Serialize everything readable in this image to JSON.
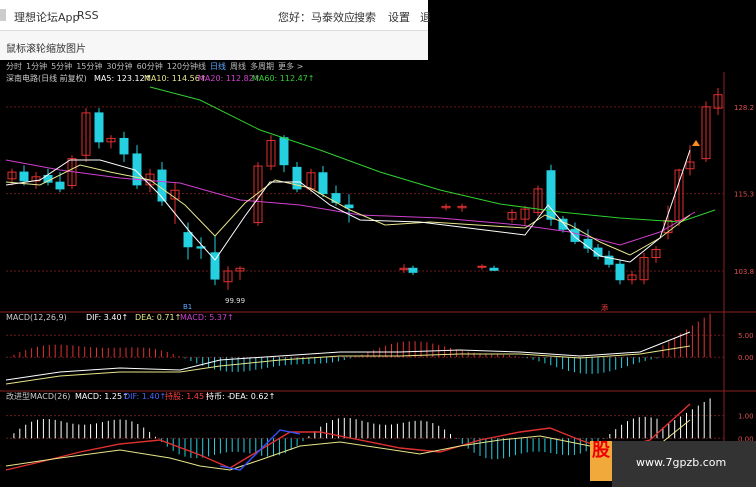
{
  "header": {
    "brand": "理想论坛App",
    "rss": "RSS",
    "greeting": "您好：马泰效应",
    "search_label": "搜索",
    "settings_label": "设置",
    "more_label": "退"
  },
  "subbar": {
    "text": "鼠标滚轮缩放图片"
  },
  "periods": [
    "分时",
    "1分钟",
    "5分钟",
    "15分钟",
    "30分钟",
    "60分钟",
    "120分钟线",
    "日线",
    "周线",
    "多周期",
    "更多 >"
  ],
  "active_period": "日线",
  "colors": {
    "bg": "#000000",
    "up": "#e03030",
    "down": "#25d0e0",
    "ma5": "#ffffff",
    "ma10": "#e8e68a",
    "ma20": "#d040d0",
    "ma60": "#30d030",
    "grid": "#6a1a1a"
  },
  "main": {
    "stock_title": "深南电路(日线 前复权)",
    "ma5": "MA5: 123.12↑",
    "ma10": "MA10: 114.56↑",
    "ma20": "MA20: 112.82↑",
    "ma60": "MA60: 112.47↑",
    "low_marker": "99.99",
    "marker_b1": "B1",
    "marker_red": "添"
  },
  "macd1": {
    "title": "MACD(12,26,9)",
    "dif": "DIF: 3.40↑",
    "dea": "DEA: 0.71↑",
    "macd": "MACD: 5.37↑"
  },
  "macd2": {
    "title": "改进型MACD(26)",
    "macd": "MACD: 1.25↑",
    "dif": "DIF: 1.40↑",
    "hold": "持股: 1.45↑",
    "hold_coin": "持币: -",
    "dea": "DEA: 0.62↑"
  },
  "watermark": {
    "logo": "股",
    "site": "www.7gpzb.com"
  },
  "chart_data": [
    {
      "type": "candlestick",
      "series_name": "深南电路",
      "y_ticks": [
        "128.2",
        "115.3",
        "103.8"
      ],
      "ylim": [
        98,
        131
      ],
      "x": [
        1,
        2,
        3,
        4,
        5,
        6,
        7,
        8,
        9,
        10,
        11,
        12,
        13,
        14,
        15,
        16,
        17,
        18,
        19,
        20,
        21,
        22,
        23,
        24,
        25,
        26,
        27,
        28,
        29,
        30,
        31,
        32,
        33,
        34,
        35,
        36,
        37,
        38,
        39,
        40,
        41,
        42,
        43,
        44,
        45,
        46,
        47,
        48,
        49,
        50,
        51,
        52,
        53,
        54,
        55,
        56,
        57,
        58,
        59,
        60,
        61,
        62,
        63,
        64,
        65,
        66,
        67,
        68,
        69,
        70
      ],
      "candles": [
        {
          "o": 117.5,
          "h": 119,
          "l": 116.5,
          "c": 118.5
        },
        {
          "o": 118.5,
          "h": 119.5,
          "l": 116.5,
          "c": 117.2
        },
        {
          "o": 117.2,
          "h": 118.5,
          "l": 116,
          "c": 117.8
        },
        {
          "o": 118,
          "h": 119,
          "l": 116.5,
          "c": 117
        },
        {
          "o": 117,
          "h": 118.5,
          "l": 115.5,
          "c": 116
        },
        {
          "o": 116.5,
          "h": 121,
          "l": 116,
          "c": 120.5
        },
        {
          "o": 121,
          "h": 128,
          "l": 120,
          "c": 127.3
        },
        {
          "o": 127.3,
          "h": 128,
          "l": 122,
          "c": 123
        },
        {
          "o": 123,
          "h": 124,
          "l": 122,
          "c": 123.5
        },
        {
          "o": 123.5,
          "h": 124.5,
          "l": 120,
          "c": 121.2
        },
        {
          "o": 121.2,
          "h": 122.5,
          "l": 116,
          "c": 116.6
        },
        {
          "o": 116.6,
          "h": 119,
          "l": 115.5,
          "c": 118.2
        },
        {
          "o": 118.8,
          "h": 120,
          "l": 113.5,
          "c": 114.2
        },
        {
          "o": 114.5,
          "h": 117,
          "l": 110.8,
          "c": 115.8
        },
        {
          "o": 109.5,
          "h": 111,
          "l": 105.5,
          "c": 107.4
        },
        {
          "o": 107.4,
          "h": 108.8,
          "l": 105.6,
          "c": 107.2
        },
        {
          "o": 106.5,
          "h": 109,
          "l": 101.7,
          "c": 102.6
        },
        {
          "o": 102.2,
          "h": 104.5,
          "l": 101,
          "c": 103.8
        },
        {
          "o": 103.8,
          "h": 104.5,
          "l": 102.5,
          "c": 104.2
        },
        {
          "o": 111,
          "h": 120,
          "l": 110.5,
          "c": 119.4
        },
        {
          "o": 119.4,
          "h": 124,
          "l": 118.8,
          "c": 123.2
        },
        {
          "o": 123.6,
          "h": 124,
          "l": 118.5,
          "c": 119.6
        },
        {
          "o": 119.2,
          "h": 120,
          "l": 115.5,
          "c": 116
        },
        {
          "o": 116,
          "h": 119,
          "l": 115.5,
          "c": 118.4
        },
        {
          "o": 118.4,
          "h": 119.4,
          "l": 114.8,
          "c": 115.3
        },
        {
          "o": 115.3,
          "h": 116.5,
          "l": 113.5,
          "c": 114
        },
        {
          "o": 113.6,
          "h": 115.2,
          "l": 111,
          "c": 113.2
        },
        {
          "o": 113.2,
          "h": 113.8,
          "l": 112.8,
          "c": 113.4
        },
        {
          "o": 113.2,
          "h": 113.8,
          "l": 112.6,
          "c": 113.4
        },
        {
          "o": 104,
          "h": 104.8,
          "l": 103.5,
          "c": 104.2
        },
        {
          "o": 104.2,
          "h": 104.6,
          "l": 103.2,
          "c": 103.6
        },
        {
          "o": 104.4,
          "h": 104.8,
          "l": 104,
          "c": 104.5
        },
        {
          "o": 104.2,
          "h": 104.6,
          "l": 103.8,
          "c": 103.9
        },
        {
          "o": 111.5,
          "h": 113,
          "l": 111,
          "c": 112.5
        },
        {
          "o": 111.5,
          "h": 113.5,
          "l": 110.5,
          "c": 113
        },
        {
          "o": 112.5,
          "h": 116.5,
          "l": 112,
          "c": 116
        },
        {
          "o": 118.7,
          "h": 119.6,
          "l": 110.5,
          "c": 111.5
        },
        {
          "o": 111.5,
          "h": 112,
          "l": 109.5,
          "c": 110
        },
        {
          "o": 110,
          "h": 111,
          "l": 107.8,
          "c": 108.2
        },
        {
          "o": 108.5,
          "h": 110,
          "l": 106.5,
          "c": 107.2
        },
        {
          "o": 107.2,
          "h": 107.8,
          "l": 105.5,
          "c": 106
        },
        {
          "o": 106,
          "h": 106.8,
          "l": 104.3,
          "c": 104.8
        },
        {
          "o": 104.8,
          "h": 105.5,
          "l": 101.8,
          "c": 102.5
        },
        {
          "o": 102.5,
          "h": 103.8,
          "l": 101.8,
          "c": 103.2
        },
        {
          "o": 102.5,
          "h": 106.5,
          "l": 101.8,
          "c": 105.8
        },
        {
          "o": 105.8,
          "h": 107.5,
          "l": 105,
          "c": 107
        },
        {
          "o": 109.5,
          "h": 113.5,
          "l": 108.5,
          "c": 111.3
        },
        {
          "o": 111.3,
          "h": 119,
          "l": 110.5,
          "c": 118.8
        },
        {
          "o": 119,
          "h": 122.5,
          "l": 118,
          "c": 120
        },
        {
          "o": 120.5,
          "h": 129,
          "l": 120,
          "c": 128.2
        },
        {
          "o": 128,
          "h": 131,
          "l": 127,
          "c": 130
        }
      ],
      "ma": [
        {
          "name": "MA5",
          "value": "123.12"
        },
        {
          "name": "MA10",
          "value": "114.56"
        },
        {
          "name": "MA20",
          "value": "112.82"
        },
        {
          "name": "MA60",
          "value": "112.47"
        }
      ]
    },
    {
      "type": "bar",
      "series_name": "MACD(12,26,9)",
      "y_ticks": [
        "5.00",
        "0.00"
      ],
      "ylim": [
        -7,
        8
      ],
      "series": [
        {
          "name": "DIF",
          "value": "3.40"
        },
        {
          "name": "DEA",
          "value": "0.71"
        },
        {
          "name": "MACD",
          "value": "5.37"
        }
      ]
    },
    {
      "type": "bar",
      "series_name": "改进型MACD(26)",
      "y_ticks": [
        "1.00",
        "0.00"
      ],
      "ylim": [
        -1.4,
        1.6
      ],
      "series": [
        {
          "name": "MACD",
          "value": "1.25"
        },
        {
          "name": "DIF",
          "value": "1.40"
        },
        {
          "name": "持股",
          "value": "1.45"
        },
        {
          "name": "DEA",
          "value": "0.62"
        }
      ]
    }
  ]
}
